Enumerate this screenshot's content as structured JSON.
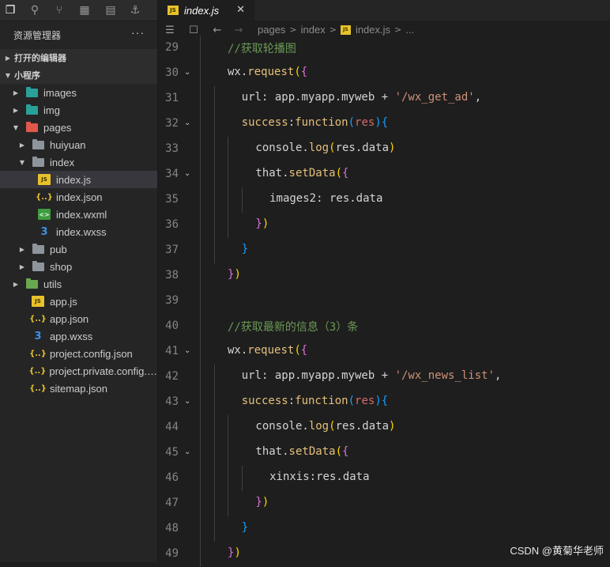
{
  "sidebar": {
    "title": "资源管理器",
    "more": "···",
    "sections": {
      "open_editors": "打开的编辑器",
      "project": "小程序"
    },
    "tree": [
      {
        "label": "images",
        "icon": "folder-teal",
        "depth": 0,
        "arrow": "▶"
      },
      {
        "label": "img",
        "icon": "folder-teal",
        "depth": 0,
        "arrow": "▶"
      },
      {
        "label": "pages",
        "icon": "folder-red",
        "depth": 0,
        "arrow": "▼"
      },
      {
        "label": "huiyuan",
        "icon": "folder",
        "depth": 1,
        "arrow": "▶"
      },
      {
        "label": "index",
        "icon": "folder-open",
        "depth": 1,
        "arrow": "▼"
      },
      {
        "label": "index.js",
        "icon": "js",
        "depth": 2,
        "arrow": "",
        "selected": true
      },
      {
        "label": "index.json",
        "icon": "json",
        "depth": 2,
        "arrow": ""
      },
      {
        "label": "index.wxml",
        "icon": "wxml",
        "depth": 2,
        "arrow": ""
      },
      {
        "label": "index.wxss",
        "icon": "wxss",
        "depth": 2,
        "arrow": ""
      },
      {
        "label": "pub",
        "icon": "folder",
        "depth": 1,
        "arrow": "▶"
      },
      {
        "label": "shop",
        "icon": "folder",
        "depth": 1,
        "arrow": "▶"
      },
      {
        "label": "utils",
        "icon": "folder-green",
        "depth": 0,
        "arrow": "▶"
      },
      {
        "label": "app.js",
        "icon": "js",
        "depth": 1,
        "arrow": ""
      },
      {
        "label": "app.json",
        "icon": "json",
        "depth": 1,
        "arrow": ""
      },
      {
        "label": "app.wxss",
        "icon": "wxss",
        "depth": 1,
        "arrow": ""
      },
      {
        "label": "project.config.json",
        "icon": "json",
        "depth": 1,
        "arrow": ""
      },
      {
        "label": "project.private.config.js...",
        "icon": "json",
        "depth": 1,
        "arrow": ""
      },
      {
        "label": "sitemap.json",
        "icon": "json",
        "depth": 1,
        "arrow": ""
      }
    ]
  },
  "tab": {
    "label": "index.js",
    "icon_text": "JS",
    "close": "✕"
  },
  "breadcrumb": {
    "items": [
      "pages",
      "index",
      "index.js",
      "..."
    ],
    "icon_text": "JS"
  },
  "code": {
    "lines": [
      {
        "n": "29",
        "fold": "",
        "indent": 1,
        "tokens": [
          [
            "cmt",
            "//获取轮播图"
          ]
        ]
      },
      {
        "n": "30",
        "fold": "⌄",
        "indent": 1,
        "tokens": [
          [
            "var",
            "wx."
          ],
          [
            "fn",
            "request"
          ],
          [
            "b1",
            "("
          ],
          [
            "b2",
            "{"
          ]
        ]
      },
      {
        "n": "31",
        "fold": "",
        "indent": 2,
        "tokens": [
          [
            "prop",
            "url"
          ],
          [
            "var",
            ": app.myapp.myweb + "
          ],
          [
            "str",
            "'/wx_get_ad'"
          ],
          [
            "var",
            ","
          ]
        ]
      },
      {
        "n": "32",
        "fold": "⌄",
        "indent": 2,
        "tokens": [
          [
            "kw",
            "success"
          ],
          [
            "var",
            ":"
          ],
          [
            "kw",
            "function"
          ],
          [
            "b3",
            "("
          ],
          [
            "param",
            "res"
          ],
          [
            "b3",
            ")"
          ],
          [
            "b3",
            "{"
          ]
        ]
      },
      {
        "n": "33",
        "fold": "",
        "indent": 3,
        "tokens": [
          [
            "var",
            "console."
          ],
          [
            "fn",
            "log"
          ],
          [
            "b1",
            "("
          ],
          [
            "var",
            "res.data"
          ],
          [
            "b1",
            ")"
          ]
        ]
      },
      {
        "n": "34",
        "fold": "⌄",
        "indent": 3,
        "tokens": [
          [
            "var",
            "that."
          ],
          [
            "fn",
            "setData"
          ],
          [
            "b1",
            "("
          ],
          [
            "b2",
            "{"
          ]
        ]
      },
      {
        "n": "35",
        "fold": "",
        "indent": 4,
        "tokens": [
          [
            "prop",
            "images2"
          ],
          [
            "var",
            ": res.data"
          ]
        ]
      },
      {
        "n": "36",
        "fold": "",
        "indent": 3,
        "tokens": [
          [
            "b2",
            "}"
          ],
          [
            "b1",
            ")"
          ]
        ]
      },
      {
        "n": "37",
        "fold": "",
        "indent": 2,
        "tokens": [
          [
            "b3",
            "}"
          ]
        ]
      },
      {
        "n": "38",
        "fold": "",
        "indent": 1,
        "tokens": [
          [
            "b2",
            "}"
          ],
          [
            "b1",
            ")"
          ]
        ]
      },
      {
        "n": "39",
        "fold": "",
        "indent": 1,
        "tokens": []
      },
      {
        "n": "40",
        "fold": "",
        "indent": 1,
        "tokens": [
          [
            "cmt",
            "//获取最新的信息（3）条"
          ]
        ]
      },
      {
        "n": "41",
        "fold": "⌄",
        "indent": 1,
        "tokens": [
          [
            "var",
            "wx."
          ],
          [
            "fn",
            "request"
          ],
          [
            "b1",
            "("
          ],
          [
            "b2",
            "{"
          ]
        ]
      },
      {
        "n": "42",
        "fold": "",
        "indent": 2,
        "tokens": [
          [
            "prop",
            "url"
          ],
          [
            "var",
            ": app.myapp.myweb + "
          ],
          [
            "str",
            "'/wx_news_list'"
          ],
          [
            "var",
            ","
          ]
        ]
      },
      {
        "n": "43",
        "fold": "⌄",
        "indent": 2,
        "tokens": [
          [
            "kw",
            "success"
          ],
          [
            "var",
            ":"
          ],
          [
            "kw",
            "function"
          ],
          [
            "b3",
            "("
          ],
          [
            "param",
            "res"
          ],
          [
            "b3",
            ")"
          ],
          [
            "b3",
            "{"
          ]
        ]
      },
      {
        "n": "44",
        "fold": "",
        "indent": 3,
        "tokens": [
          [
            "var",
            "console."
          ],
          [
            "fn",
            "log"
          ],
          [
            "b1",
            "("
          ],
          [
            "var",
            "res.data"
          ],
          [
            "b1",
            ")"
          ]
        ]
      },
      {
        "n": "45",
        "fold": "⌄",
        "indent": 3,
        "tokens": [
          [
            "var",
            "that."
          ],
          [
            "fn",
            "setData"
          ],
          [
            "b1",
            "("
          ],
          [
            "b2",
            "{"
          ]
        ]
      },
      {
        "n": "46",
        "fold": "",
        "indent": 4,
        "tokens": [
          [
            "prop",
            "xinxis"
          ],
          [
            "var",
            ":res.data"
          ]
        ]
      },
      {
        "n": "47",
        "fold": "",
        "indent": 3,
        "tokens": [
          [
            "b2",
            "}"
          ],
          [
            "b1",
            ")"
          ]
        ]
      },
      {
        "n": "48",
        "fold": "",
        "indent": 2,
        "tokens": [
          [
            "b3",
            "}"
          ]
        ]
      },
      {
        "n": "49",
        "fold": "",
        "indent": 1,
        "tokens": [
          [
            "b2",
            "}"
          ],
          [
            "b1",
            ")"
          ]
        ]
      }
    ]
  },
  "watermark": "CSDN @黄菊华老师"
}
